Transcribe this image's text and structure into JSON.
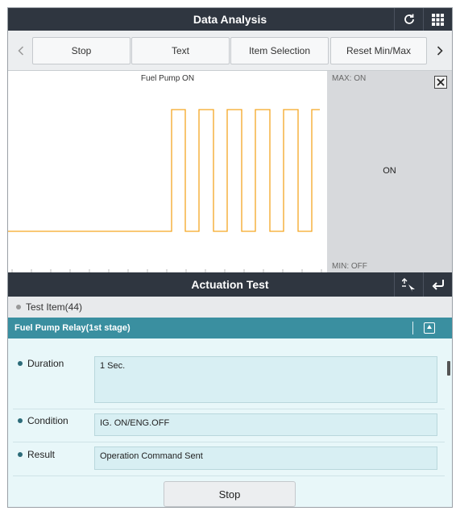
{
  "header": {
    "title": "Data Analysis",
    "refresh_icon": "refresh-icon",
    "grid_icon": "grid-menu-icon"
  },
  "toolbar": {
    "prev_icon": "chevron-left-icon",
    "next_icon": "chevron-right-icon",
    "buttons": [
      "Stop",
      "Text",
      "Item Selection",
      "Reset Min/Max"
    ]
  },
  "graph": {
    "title": "Fuel Pump ON",
    "max_label": "MAX: ON",
    "min_label": "MIN: OFF",
    "current_value": "ON",
    "close_icon": "close-icon",
    "line_color": "#f5a623"
  },
  "chart_data": {
    "type": "line",
    "title": "Fuel Pump ON",
    "series": [
      {
        "name": "Fuel Pump ON",
        "states": [
          "OFF",
          "ON",
          "OFF",
          "ON",
          "OFF",
          "ON",
          "OFF",
          "ON",
          "OFF",
          "ON",
          "OFF",
          "ON"
        ],
        "values": [
          0,
          1,
          0,
          1,
          0,
          1,
          0,
          1,
          0,
          1,
          0,
          1
        ]
      }
    ],
    "ylim": [
      "OFF",
      "ON"
    ],
    "grid": false
  },
  "actuation": {
    "title": "Actuation Test",
    "expand_icon": "expand-arrows-icon",
    "back_icon": "back-arrow-icon",
    "test_item_label": "Test Item(44)",
    "selected_test": "Fuel Pump Relay(1st stage)",
    "collapse_icon": "collapse-up-icon",
    "rows": [
      {
        "label": "Duration",
        "value": "1 Sec."
      },
      {
        "label": "Condition",
        "value": "IG. ON/ENG.OFF"
      },
      {
        "label": "Result",
        "value": "Operation Command Sent"
      }
    ],
    "stop_label": "Stop"
  }
}
